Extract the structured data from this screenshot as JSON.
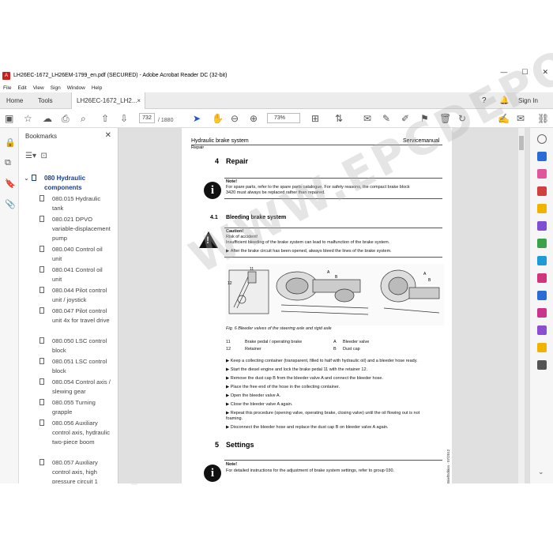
{
  "window": {
    "title": "LH26EC-1672_LH26EM-1799_en.pdf (SECURED) - Adobe Acrobat Reader DC (32-bit)",
    "controls": [
      "—",
      "☐",
      "✕"
    ]
  },
  "menu": [
    "File",
    "Edit",
    "View",
    "Sign",
    "Window",
    "Help"
  ],
  "tabs": {
    "home": "Home",
    "tools": "Tools",
    "doc": "LH26EC-1672_LH2...",
    "close": "×",
    "help": "?",
    "signin": "Sign In"
  },
  "toolbar": {
    "page_current": "732",
    "page_total": "/ 1880",
    "zoom": "73%"
  },
  "bookmarks": {
    "header": "Bookmarks",
    "close": "✕",
    "top_item": "080 Hydraulic components",
    "items": [
      "080.015 Hydraulic tank",
      "080.021 DPVO variable-displacement pump",
      "080.040 Control oil unit",
      "080.041 Control oil unit",
      "080.044 Pilot control unit / joystick",
      "080.047 Pilot control unit 4x for travel drive",
      "080.050 LSC control block",
      "080.051 LSC control block",
      "080.054 Control axis / slewing gear",
      "080.055 Turning grapple",
      "080.056 Auxiliary control axis, hydraulic two-piece boom",
      "080.057 Auxiliary control axis, high pressure circuit 1 (HKK1)"
    ]
  },
  "document": {
    "header_left": "Hydraulic brake system",
    "header_sub": "Repair",
    "header_right": "Servicemanual",
    "sec4_num": "4",
    "sec4_title": "Repair",
    "note1_title": "Note!",
    "note1_line1": "For spare parts, refer to the spare parts catalogue. For safety reasons, the compact brake block",
    "note1_line2": "3420 must always be replaced rather than repaired.",
    "sec41_num": "4.1",
    "sec41_title": "Bleeding brake system",
    "caution_title": "Caution!",
    "caution_line1": "Risk of accident!",
    "caution_line2": "Insufficient bleeding of the brake system can lead to malfunction of the brake system.",
    "caution_line3": "After the brake circuit has been opened, always bleed the lines of the brake system.",
    "fig_caption": "Fig. 6        Bleeder valves of the steering axle and rigid axle",
    "legend": [
      {
        "num": "11",
        "label": "Brake pedal / operating brake",
        "key": "A",
        "desc": "Bleeder valve"
      },
      {
        "num": "12",
        "label": "Retainer",
        "key": "B",
        "desc": "Dust cap"
      }
    ],
    "steps": [
      "Keep a collecting container (transparent, filled to half with hydraulic oil) and a bleeder hose ready.",
      "Start the diesel engine and lock the brake pedal 11 with the retainer 12.",
      "Remove the dust cap B from the bleeder valve A and connect the bleeder hose.",
      "Place the free end of the hose in the collecting container.",
      "Open the bleeder valve A.",
      "Close the bleeder valve A again.",
      "Repeat this procedure (opening valve, operating brake, closing valve) until the oil flowing out is not foaming.",
      "Disconnect the bleeder hose and replace the dust cap B on bleeder valve A again."
    ],
    "sec5_num": "5",
    "sec5_title": "Settings",
    "note2_title": "Note!",
    "note2_line1": "For detailed instructions for the adjustment of brake system settings, refer to group 030.",
    "side_code": "BriefEdition · 07/2012",
    "watermark": "WWW.EPCDEPO.COM"
  }
}
